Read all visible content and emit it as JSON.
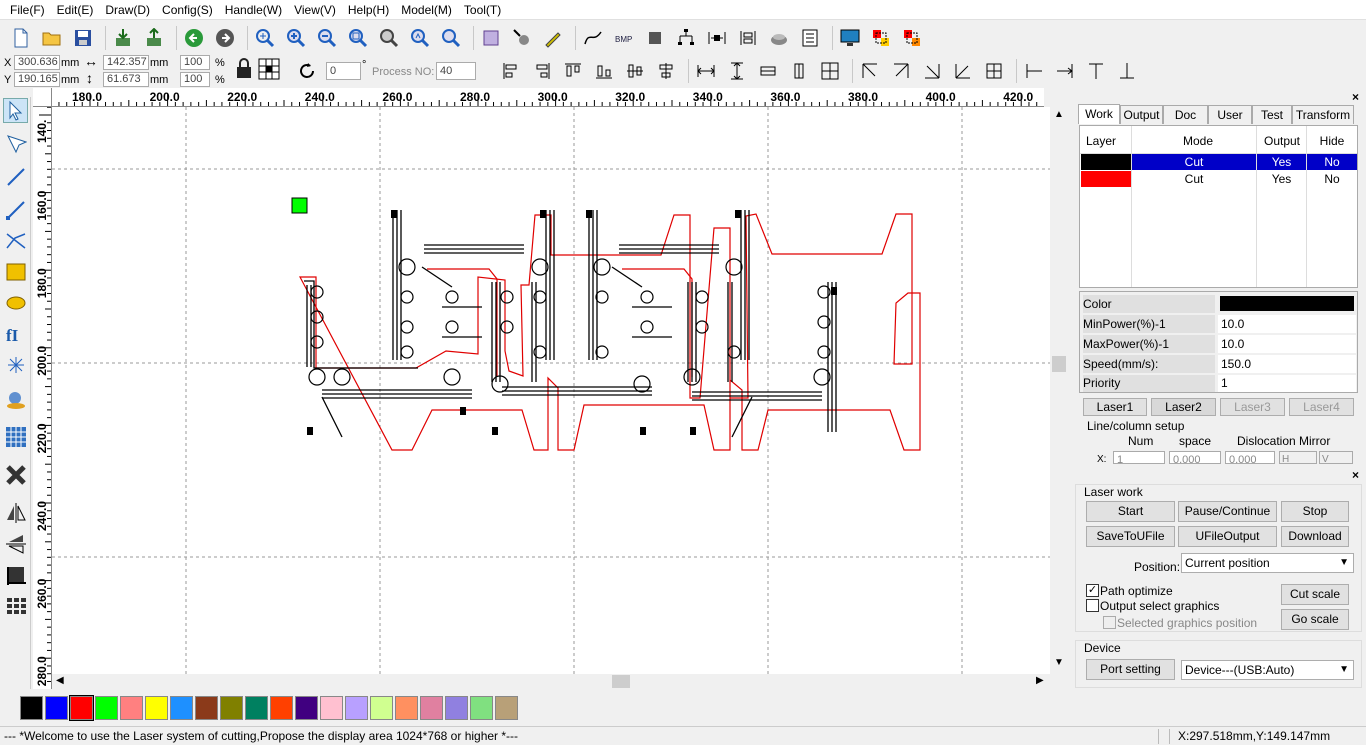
{
  "menu": [
    "File(F)",
    "Edit(E)",
    "Draw(D)",
    "Config(S)",
    "Handle(W)",
    "View(V)",
    "Help(H)",
    "Model(M)",
    "Tool(T)"
  ],
  "coords": {
    "x_label": "X",
    "y_label": "Y",
    "x_value": "300.636",
    "y_value": "190.165",
    "unit": "mm",
    "w_value": "142.357",
    "h_value": "61.673",
    "w_unit": "mm",
    "h_unit": "mm",
    "scale_x": "100",
    "scale_y": "100",
    "pct": "%",
    "angle": "0",
    "degree": "°",
    "process_label": "Process NO:",
    "process_value": "40"
  },
  "ruler": {
    "h_ticks": [
      "180.0",
      "200.0",
      "220.0",
      "240.0",
      "260.0",
      "280.0",
      "300.0",
      "320.0",
      "340.0",
      "360.0",
      "380.0",
      "400.0",
      "420.0"
    ],
    "v_ticks": [
      "140.",
      "160.0",
      "180.0",
      "200.0",
      "220.0",
      "240.0",
      "260.0",
      "280.0"
    ]
  },
  "tabs": [
    "Work",
    "Output",
    "Doc",
    "User",
    "Test",
    "Transform"
  ],
  "layers": {
    "headers": [
      "Layer",
      "Mode",
      "Output",
      "Hide"
    ],
    "rows": [
      {
        "color": "#000000",
        "mode": "Cut",
        "output": "Yes",
        "hide": "No",
        "selected": true
      },
      {
        "color": "#ff0000",
        "mode": "Cut",
        "output": "Yes",
        "hide": "No",
        "selected": false
      }
    ]
  },
  "props": {
    "rows": [
      {
        "label": "Color",
        "value": ""
      },
      {
        "label": "MinPower(%)-1",
        "value": "10.0"
      },
      {
        "label": "MaxPower(%)-1",
        "value": "10.0"
      },
      {
        "label": "Speed(mm/s):",
        "value": "150.0"
      },
      {
        "label": "Priority",
        "value": "1"
      }
    ],
    "color": "#000000"
  },
  "lasers": [
    "Laser1",
    "Laser2",
    "Laser3",
    "Laser4"
  ],
  "linecol": {
    "title": "Line/column setup",
    "headers": [
      "Num",
      "space",
      "Dislocation",
      "Mirror"
    ],
    "row_label": "X:",
    "num": "1",
    "space": "0.000",
    "dislocation": "0.000",
    "mirror_h": "H",
    "mirror_v": "V"
  },
  "laserwork": {
    "title": "Laser work",
    "start": "Start",
    "pause": "Pause/Continue",
    "stop": "Stop",
    "save": "SaveToUFile",
    "ufile": "UFileOutput",
    "download": "Download",
    "position_label": "Position:",
    "position_value": "Current position",
    "path_optimize": "Path optimize",
    "output_select": "Output select graphics",
    "selected_pos": "Selected graphics position",
    "cut_scale": "Cut scale",
    "go_scale": "Go scale"
  },
  "device": {
    "title": "Device",
    "port": "Port setting",
    "device_value": "Device---(USB:Auto)"
  },
  "palette": [
    "#000000",
    "#0000ff",
    "#ff0000",
    "#00ff00",
    "#ff8080",
    "#ffff00",
    "#1e90ff",
    "#8b3a1a",
    "#808000",
    "#008060",
    "#ff4000",
    "#400080",
    "#ffc0d0",
    "#b8a0ff",
    "#d0ff90",
    "#ff9060",
    "#e080a0",
    "#9080e0",
    "#80e080",
    "#b8a078"
  ],
  "status": {
    "message": "--- *Welcome to use the Laser system of cutting,Propose the display area 1024*768 or higher *---",
    "coords": "X:297.518mm,Y:149.147mm"
  }
}
